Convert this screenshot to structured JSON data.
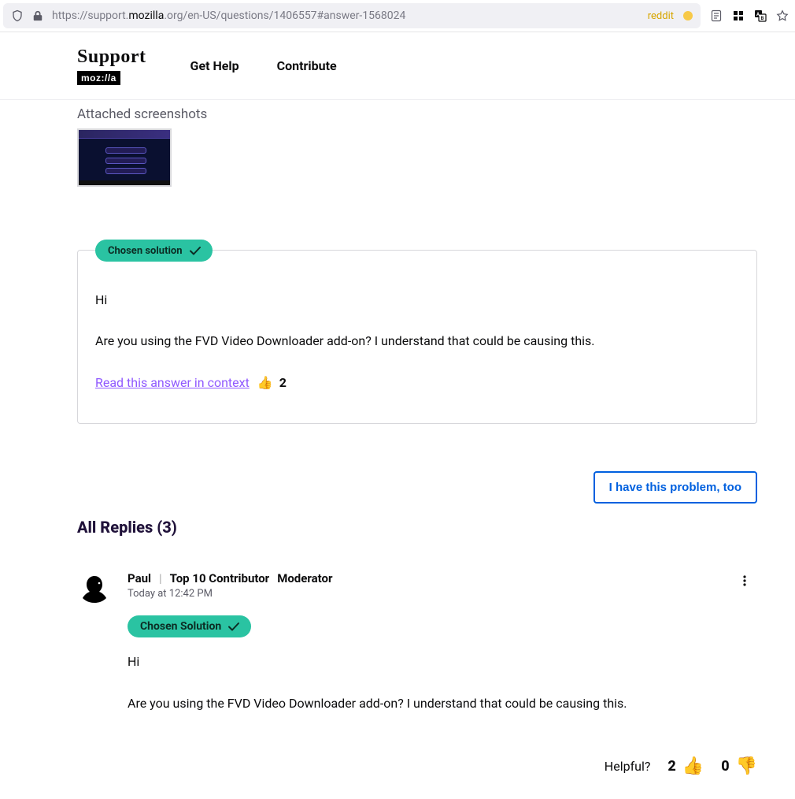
{
  "browser": {
    "url_prefix": "https://support.",
    "url_bold": "mozilla",
    "url_suffix": ".org/en-US/questions/1406557#answer-1568024",
    "reddit_label": "reddit"
  },
  "header": {
    "brand_title": "Support",
    "brand_badge": "moz://a",
    "nav": {
      "get_help": "Get Help",
      "contribute": "Contribute"
    }
  },
  "question": {
    "attachments_label": "Attached screenshots"
  },
  "solution": {
    "badge": "Chosen solution",
    "line1": "Hi",
    "line2": "Are you using the FVD Video Downloader add-on? I understand that could be causing this.",
    "context_link": "Read this answer in context",
    "thumbs_icon": "👍",
    "context_votes": "2"
  },
  "actions": {
    "problem_button": "I have this problem, too"
  },
  "replies_header": "All Replies (3)",
  "reply": {
    "author": "Paul",
    "role1": "Top 10 Contributor",
    "role2": "Moderator",
    "timestamp": "Today at 12:42 PM",
    "chosen_badge": "Chosen Solution",
    "line1": "Hi",
    "line2": "Are you using the FVD Video Downloader add-on? I understand that could be causing this."
  },
  "helpful": {
    "label": "Helpful?",
    "up_count": "2",
    "down_count": "0",
    "thumbs_up": "👍",
    "thumbs_down": "👎"
  }
}
